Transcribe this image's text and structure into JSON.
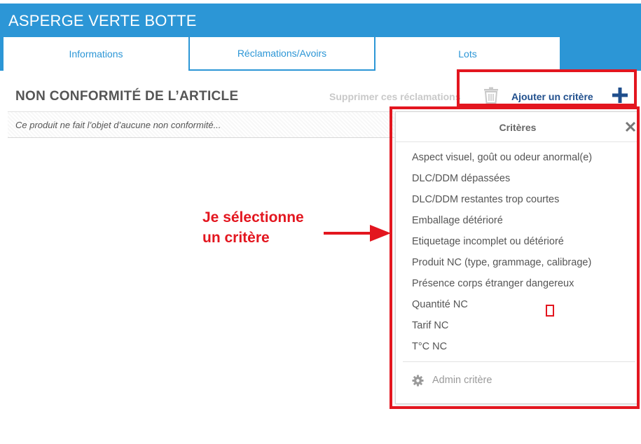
{
  "app": {
    "title": "ASPERGE VERTE BOTTE"
  },
  "tabs": [
    {
      "label": "Informations"
    },
    {
      "label": "Réclamations/Avoirs"
    },
    {
      "label": "Lots"
    }
  ],
  "section": {
    "title": "NON CONFORMITÉ DE L’ARTICLE",
    "delete_label": "Supprimer ces réclamations",
    "add_label": "Ajouter un critère",
    "empty_notice": "Ce produit ne fait l’objet d’aucune non conformité..."
  },
  "dropdown": {
    "title": "Critères",
    "items": [
      "Aspect visuel, goût ou odeur anormal(e)",
      "DLC/DDM dépassées",
      "DLC/DDM restantes trop courtes",
      "Emballage détérioré",
      "Etiquetage incomplet ou détérioré",
      "Produit NC (type, grammage, calibrage)",
      "Présence corps étranger dangereux",
      "Quantité NC",
      "Tarif NC",
      "T°C NC"
    ],
    "admin_label": "Admin critère"
  },
  "annotation": {
    "line1": "Je sélectionne",
    "line2": "un critère"
  },
  "colors": {
    "primary": "#2c96d6",
    "highlight": "#e3161f",
    "add_link": "#1f4e8c"
  },
  "icons": [
    "trash-icon",
    "plus-icon",
    "close-icon",
    "gear-icon",
    "arrow-right-icon"
  ]
}
